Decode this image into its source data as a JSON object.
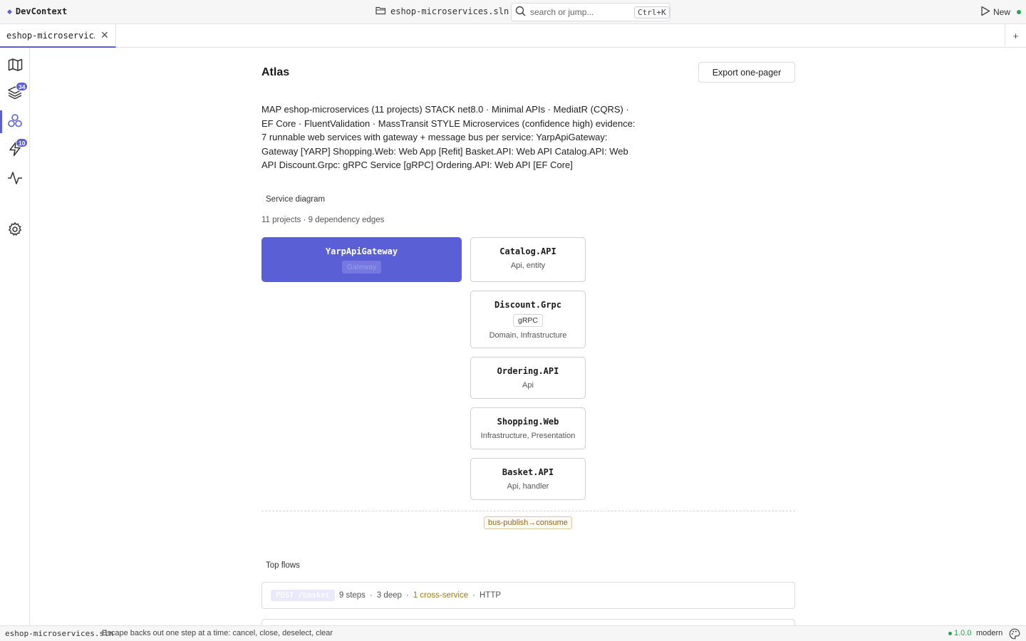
{
  "app": {
    "name": "DevContext"
  },
  "topbar": {
    "solution": "eshop-microservices.sln",
    "search_placeholder": "search or jump...",
    "search_shortcut": "Ctrl+K",
    "new_label": "New"
  },
  "tabs": [
    {
      "label": "eshop-microservic…"
    }
  ],
  "rail": {
    "badges": {
      "layers": "34",
      "flows": "10"
    },
    "items": [
      "map-icon",
      "layers-icon",
      "atlas-icon",
      "flows-icon",
      "activity-icon",
      "gear-icon"
    ]
  },
  "atlas": {
    "title": "Atlas",
    "export_label": "Export one-pager",
    "summary": "MAP eshop-microservices (11 projects) STACK net8.0 · Minimal APIs · MediatR (CQRS) · EF Core · FluentValidation · MassTransit STYLE Microservices (confidence high) evidence: 7 runnable web services with gateway + message bus per service: YarpApiGateway: Gateway [YARP] Shopping.Web: Web App [Refit] Basket.API: Web API Catalog.API: Web API Discount.Grpc: gRPC Service [gRPC] Ordering.API: Web API [EF Core]",
    "diagram_label": "Service diagram",
    "diagram_meta": "11 projects · 9 dependency edges",
    "gateway": {
      "name": "YarpApiGateway",
      "badge": "Gateway"
    },
    "services": [
      {
        "name": "Catalog.API",
        "sub": "Api, entity"
      },
      {
        "name": "Discount.Grpc",
        "badge": "gRPC",
        "sub": "Domain, Infrastructure"
      },
      {
        "name": "Ordering.API",
        "sub": "Api"
      },
      {
        "name": "Shopping.Web",
        "sub": "Infrastructure, Presentation"
      },
      {
        "name": "Basket.API",
        "sub": "Api, handler"
      }
    ],
    "bus_edge": "bus-publish→consume",
    "flows_label": "Top flows",
    "flows": [
      {
        "method": "POST /basket",
        "steps": "9 steps",
        "depth": "3 deep",
        "cross": "1 cross-service",
        "transport": "HTTP"
      }
    ]
  },
  "statusbar": {
    "solution": "eshop-microservices.sln",
    "hint": "Escape backs out one step at a time: cancel, close, deselect, clear",
    "version": "1.0.0",
    "theme": "modern"
  },
  "colors": {
    "accent": "#5b5fd6",
    "ok": "#2aa44f",
    "warn": "#a07b12"
  }
}
